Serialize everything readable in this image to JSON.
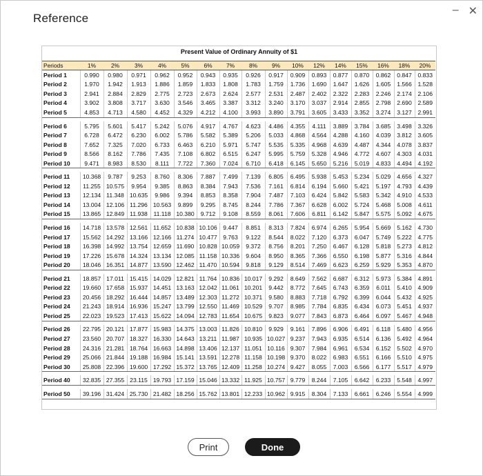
{
  "window": {
    "title": "Reference"
  },
  "table": {
    "title": "Present Value of Ordinary Annuity of $1",
    "columns": [
      "Periods",
      "1%",
      "2%",
      "3%",
      "4%",
      "5%",
      "6%",
      "7%",
      "8%",
      "9%",
      "10%",
      "12%",
      "14%",
      "15%",
      "16%",
      "18%",
      "20%"
    ],
    "groups": [
      [
        [
          "Period 1",
          "0.990",
          "0.980",
          "0.971",
          "0.962",
          "0.952",
          "0.943",
          "0.935",
          "0.926",
          "0.917",
          "0.909",
          "0.893",
          "0.877",
          "0.870",
          "0.862",
          "0.847",
          "0.833"
        ],
        [
          "Period 2",
          "1.970",
          "1.942",
          "1.913",
          "1.886",
          "1.859",
          "1.833",
          "1.808",
          "1.783",
          "1.759",
          "1.736",
          "1.690",
          "1.647",
          "1.626",
          "1.605",
          "1.566",
          "1.528"
        ],
        [
          "Period 3",
          "2.941",
          "2.884",
          "2.829",
          "2.775",
          "2.723",
          "2.673",
          "2.624",
          "2.577",
          "2.531",
          "2.487",
          "2.402",
          "2.322",
          "2.283",
          "2.246",
          "2.174",
          "2.106"
        ],
        [
          "Period 4",
          "3.902",
          "3.808",
          "3.717",
          "3.630",
          "3.546",
          "3.465",
          "3.387",
          "3.312",
          "3.240",
          "3.170",
          "3.037",
          "2.914",
          "2.855",
          "2.798",
          "2.690",
          "2.589"
        ],
        [
          "Period 5",
          "4.853",
          "4.713",
          "4.580",
          "4.452",
          "4.329",
          "4.212",
          "4.100",
          "3.993",
          "3.890",
          "3.791",
          "3.605",
          "3.433",
          "3.352",
          "3.274",
          "3.127",
          "2.991"
        ]
      ],
      [
        [
          "Period 6",
          "5.795",
          "5.601",
          "5.417",
          "5.242",
          "5.076",
          "4.917",
          "4.767",
          "4.623",
          "4.486",
          "4.355",
          "4.111",
          "3.889",
          "3.784",
          "3.685",
          "3.498",
          "3.326"
        ],
        [
          "Period 7",
          "6.728",
          "6.472",
          "6.230",
          "6.002",
          "5.786",
          "5.582",
          "5.389",
          "5.206",
          "5.033",
          "4.868",
          "4.564",
          "4.288",
          "4.160",
          "4.039",
          "3.812",
          "3.605"
        ],
        [
          "Period 8",
          "7.652",
          "7.325",
          "7.020",
          "6.733",
          "6.463",
          "6.210",
          "5.971",
          "5.747",
          "5.535",
          "5.335",
          "4.968",
          "4.639",
          "4.487",
          "4.344",
          "4.078",
          "3.837"
        ],
        [
          "Period 9",
          "8.566",
          "8.162",
          "7.786",
          "7.435",
          "7.108",
          "6.802",
          "6.515",
          "6.247",
          "5.995",
          "5.759",
          "5.328",
          "4.946",
          "4.772",
          "4.607",
          "4.303",
          "4.031"
        ],
        [
          "Period 10",
          "9.471",
          "8.983",
          "8.530",
          "8.111",
          "7.722",
          "7.360",
          "7.024",
          "6.710",
          "6.418",
          "6.145",
          "5.650",
          "5.216",
          "5.019",
          "4.833",
          "4.494",
          "4.192"
        ]
      ],
      [
        [
          "Period 11",
          "10.368",
          "9.787",
          "9.253",
          "8.760",
          "8.306",
          "7.887",
          "7.499",
          "7.139",
          "6.805",
          "6.495",
          "5.938",
          "5.453",
          "5.234",
          "5.029",
          "4.656",
          "4.327"
        ],
        [
          "Period 12",
          "11.255",
          "10.575",
          "9.954",
          "9.385",
          "8.863",
          "8.384",
          "7.943",
          "7.536",
          "7.161",
          "6.814",
          "6.194",
          "5.660",
          "5.421",
          "5.197",
          "4.793",
          "4.439"
        ],
        [
          "Period 13",
          "12.134",
          "11.348",
          "10.635",
          "9.986",
          "9.394",
          "8.853",
          "8.358",
          "7.904",
          "7.487",
          "7.103",
          "6.424",
          "5.842",
          "5.583",
          "5.342",
          "4.910",
          "4.533"
        ],
        [
          "Period 14",
          "13.004",
          "12.106",
          "11.296",
          "10.563",
          "9.899",
          "9.295",
          "8.745",
          "8.244",
          "7.786",
          "7.367",
          "6.628",
          "6.002",
          "5.724",
          "5.468",
          "5.008",
          "4.611"
        ],
        [
          "Period 15",
          "13.865",
          "12.849",
          "11.938",
          "11.118",
          "10.380",
          "9.712",
          "9.108",
          "8.559",
          "8.061",
          "7.606",
          "6.811",
          "6.142",
          "5.847",
          "5.575",
          "5.092",
          "4.675"
        ]
      ],
      [
        [
          "Period 16",
          "14.718",
          "13.578",
          "12.561",
          "11.652",
          "10.838",
          "10.106",
          "9.447",
          "8.851",
          "8.313",
          "7.824",
          "6.974",
          "6.265",
          "5.954",
          "5.669",
          "5.162",
          "4.730"
        ],
        [
          "Period 17",
          "15.562",
          "14.292",
          "13.166",
          "12.166",
          "11.274",
          "10.477",
          "9.763",
          "9.122",
          "8.544",
          "8.022",
          "7.120",
          "6.373",
          "6.047",
          "5.749",
          "5.222",
          "4.775"
        ],
        [
          "Period 18",
          "16.398",
          "14.992",
          "13.754",
          "12.659",
          "11.690",
          "10.828",
          "10.059",
          "9.372",
          "8.756",
          "8.201",
          "7.250",
          "6.467",
          "6.128",
          "5.818",
          "5.273",
          "4.812"
        ],
        [
          "Period 19",
          "17.226",
          "15.678",
          "14.324",
          "13.134",
          "12.085",
          "11.158",
          "10.336",
          "9.604",
          "8.950",
          "8.365",
          "7.366",
          "6.550",
          "6.198",
          "5.877",
          "5.316",
          "4.844"
        ],
        [
          "Period 20",
          "18.046",
          "16.351",
          "14.877",
          "13.590",
          "12.462",
          "11.470",
          "10.594",
          "9.818",
          "9.129",
          "8.514",
          "7.469",
          "6.623",
          "6.259",
          "5.929",
          "5.353",
          "4.870"
        ]
      ],
      [
        [
          "Period 21",
          "18.857",
          "17.011",
          "15.415",
          "14.029",
          "12.821",
          "11.764",
          "10.836",
          "10.017",
          "9.292",
          "8.649",
          "7.562",
          "6.687",
          "6.312",
          "5.973",
          "5.384",
          "4.891"
        ],
        [
          "Period 22",
          "19.660",
          "17.658",
          "15.937",
          "14.451",
          "13.163",
          "12.042",
          "11.061",
          "10.201",
          "9.442",
          "8.772",
          "7.645",
          "6.743",
          "6.359",
          "6.011",
          "5.410",
          "4.909"
        ],
        [
          "Period 23",
          "20.456",
          "18.292",
          "16.444",
          "14.857",
          "13.489",
          "12.303",
          "11.272",
          "10.371",
          "9.580",
          "8.883",
          "7.718",
          "6.792",
          "6.399",
          "6.044",
          "5.432",
          "4.925"
        ],
        [
          "Period 24",
          "21.243",
          "18.914",
          "16.936",
          "15.247",
          "13.799",
          "12.550",
          "11.469",
          "10.529",
          "9.707",
          "8.985",
          "7.784",
          "6.835",
          "6.434",
          "6.073",
          "5.451",
          "4.937"
        ],
        [
          "Period 25",
          "22.023",
          "19.523",
          "17.413",
          "15.622",
          "14.094",
          "12.783",
          "11.654",
          "10.675",
          "9.823",
          "9.077",
          "7.843",
          "6.873",
          "6.464",
          "6.097",
          "5.467",
          "4.948"
        ]
      ],
      [
        [
          "Period 26",
          "22.795",
          "20.121",
          "17.877",
          "15.983",
          "14.375",
          "13.003",
          "11.826",
          "10.810",
          "9.929",
          "9.161",
          "7.896",
          "6.906",
          "6.491",
          "6.118",
          "5.480",
          "4.956"
        ],
        [
          "Period 27",
          "23.560",
          "20.707",
          "18.327",
          "16.330",
          "14.643",
          "13.211",
          "11.987",
          "10.935",
          "10.027",
          "9.237",
          "7.943",
          "6.935",
          "6.514",
          "6.136",
          "5.492",
          "4.964"
        ],
        [
          "Period 28",
          "24.316",
          "21.281",
          "18.764",
          "16.663",
          "14.898",
          "13.406",
          "12.137",
          "11.051",
          "10.116",
          "9.307",
          "7.984",
          "6.961",
          "6.534",
          "6.152",
          "5.502",
          "4.970"
        ],
        [
          "Period 29",
          "25.066",
          "21.844",
          "19.188",
          "16.984",
          "15.141",
          "13.591",
          "12.278",
          "11.158",
          "10.198",
          "9.370",
          "8.022",
          "6.983",
          "6.551",
          "6.166",
          "5.510",
          "4.975"
        ],
        [
          "Period 30",
          "25.808",
          "22.396",
          "19.600",
          "17.292",
          "15.372",
          "13.765",
          "12.409",
          "11.258",
          "10.274",
          "9.427",
          "8.055",
          "7.003",
          "6.566",
          "6.177",
          "5.517",
          "4.979"
        ]
      ],
      [
        [
          "Period 40",
          "32.835",
          "27.355",
          "23.115",
          "19.793",
          "17.159",
          "15.046",
          "13.332",
          "11.925",
          "10.757",
          "9.779",
          "8.244",
          "7.105",
          "6.642",
          "6.233",
          "5.548",
          "4.997"
        ]
      ],
      [
        [
          "Period 50",
          "39.196",
          "31.424",
          "25.730",
          "21.482",
          "18.256",
          "15.762",
          "13.801",
          "12.233",
          "10.962",
          "9.915",
          "8.304",
          "7.133",
          "6.661",
          "6.246",
          "5.554",
          "4.999"
        ]
      ]
    ]
  },
  "buttons": {
    "print": "Print",
    "done": "Done"
  },
  "window_controls": {
    "minimize": "–",
    "close": "✕"
  },
  "colors": {
    "header_bg": "#fbe8bd",
    "done_bg": "#1b1b1b"
  }
}
